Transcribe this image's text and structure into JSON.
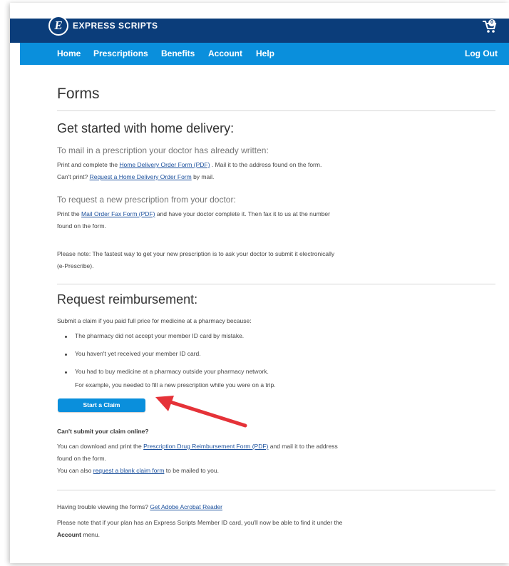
{
  "header": {
    "brand": "EXPRESS SCRIPTS",
    "brand_mark": "E",
    "cart_count": "0",
    "logo_icon": "express-scripts-logo",
    "cart_icon": "cart-icon"
  },
  "nav": {
    "items": [
      "Home",
      "Prescriptions",
      "Benefits",
      "Account",
      "Help"
    ],
    "logout": "Log Out"
  },
  "page": {
    "title": "Forms",
    "home_delivery": {
      "heading": "Get started with home delivery:",
      "mail_sub": "To mail in a prescription your doctor has already written:",
      "mail_line1_pre": "Print and complete the ",
      "mail_line1_link": "Home Delivery Order Form (PDF)",
      "mail_line1_post": " . Mail it to the address found on the form.",
      "mail_line2_pre": "Can't print? ",
      "mail_line2_link": "Request a Home Delivery Order Form",
      "mail_line2_post": " by mail.",
      "request_sub": "To request a new prescription from your doctor:",
      "request_line1_pre": "Print the ",
      "request_line1_link": "Mail Order Fax Form (PDF)",
      "request_line1_post": "  and have your doctor complete it. Then fax it to us at the number",
      "request_line2": "found on the form.",
      "note_line1": "Please note: The fastest way to get your new prescription is to ask your doctor to submit it electronically",
      "note_line2": "(e-Prescribe)."
    },
    "reimbursement": {
      "heading": "Request reimbursement:",
      "intro": "Submit a claim if you paid full price for medicine at a pharmacy because:",
      "bullets": [
        "The pharmacy did not accept your member ID card by mistake.",
        "You haven't yet received your member ID card.",
        "You had to buy medicine at a pharmacy outside your pharmacy network."
      ],
      "bullet3_cont": "For example, you needed to fill a new prescription while you were on a trip.",
      "button": "Start a Claim",
      "cant_submit": "Can't submit your claim online?",
      "download_pre": "You can download and print the ",
      "download_link": "Prescription Drug Reimbursement Form (PDF)",
      "download_post": "  and mail it to the address",
      "download_line2": "found on the form.",
      "blank_pre": "You can also ",
      "blank_link": "request a blank claim form",
      "blank_post": " to be mailed to you."
    },
    "footer": {
      "trouble_pre": "Having trouble viewing the forms? ",
      "trouble_link": "Get Adobe Acrobat Reader",
      "note_line1": "Please note that if your plan has an Express Scripts Member ID card, you'll now be able to find it under the",
      "note_bold": "Account",
      "note_post": " menu."
    }
  },
  "colors": {
    "top_bar": "#0b3d7a",
    "nav_bar": "#0a8fdc",
    "button": "#0a8fdc",
    "link": "#1a4f9c",
    "arrow": "#e53238"
  }
}
